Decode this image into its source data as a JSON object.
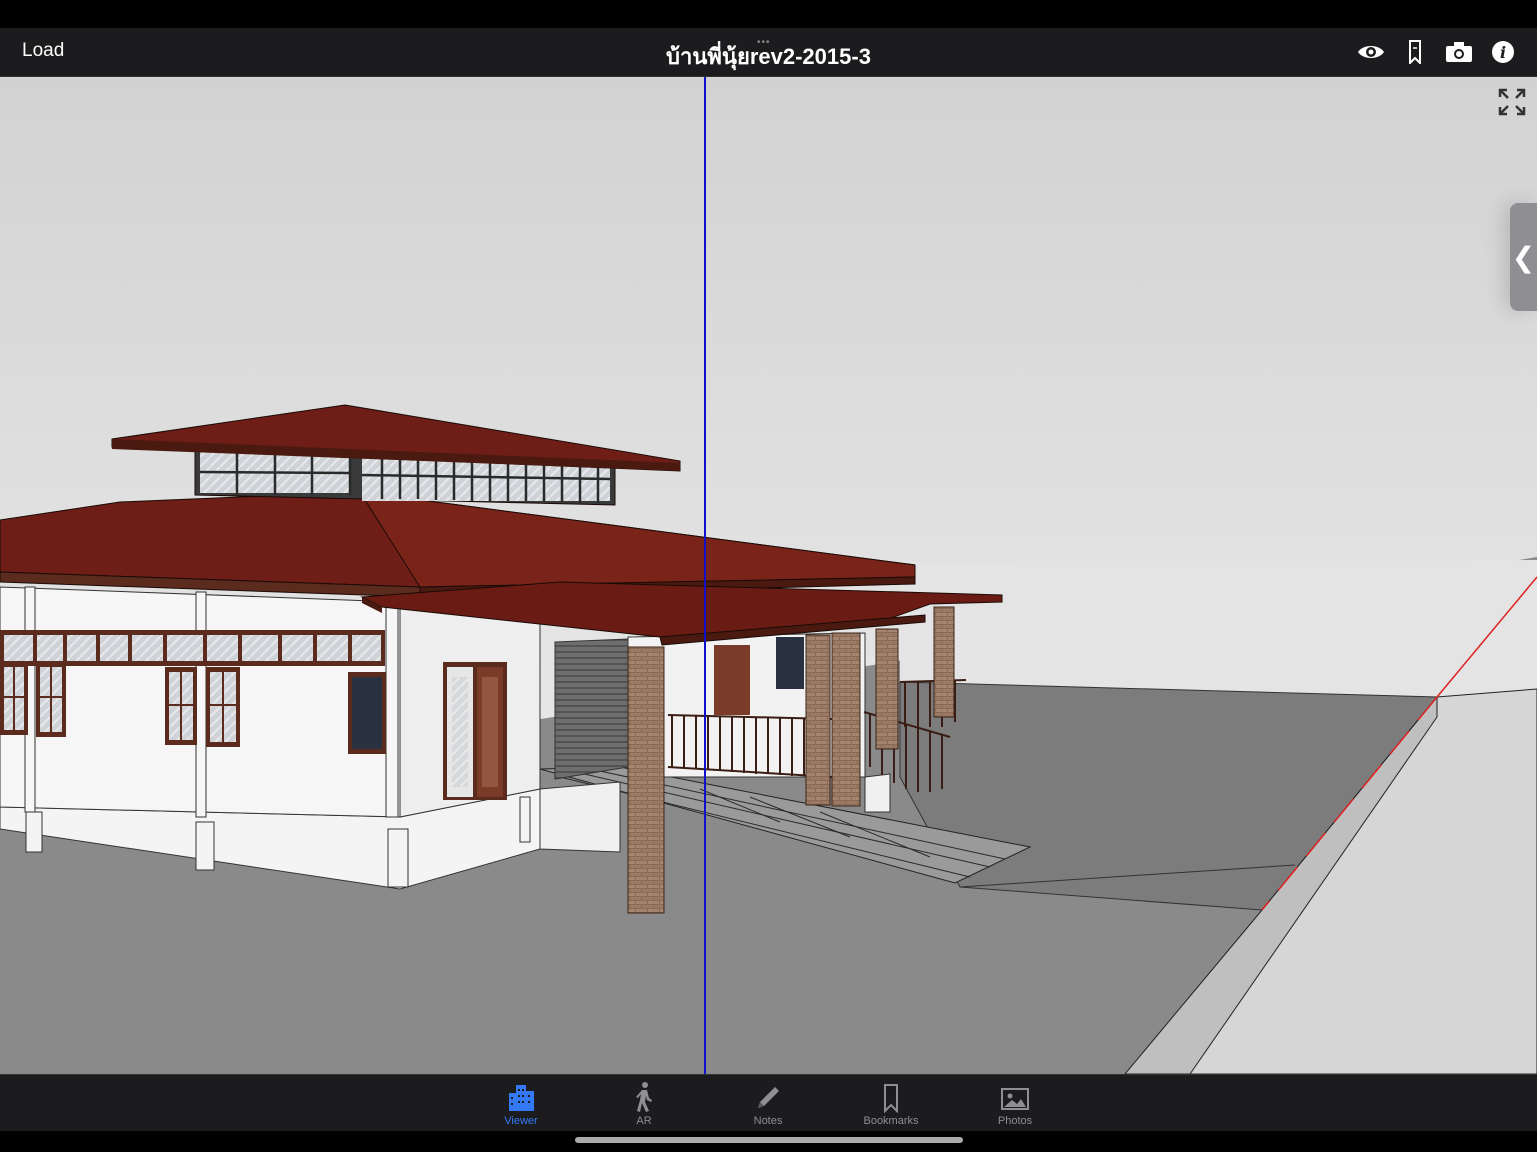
{
  "header": {
    "load_label": "Load",
    "title": "บ้านพี่นุ้ยrev2-2015-3",
    "icons": [
      "eye-icon",
      "bookmark-icon",
      "camera-icon",
      "info-icon"
    ]
  },
  "viewport": {
    "expand_icon": "expand-icon",
    "side_handle_glyph": "❮"
  },
  "tabs": [
    {
      "label": "Viewer",
      "icon": "building-icon",
      "active": true
    },
    {
      "label": "AR",
      "icon": "walking-person-icon",
      "active": false
    },
    {
      "label": "Notes",
      "icon": "pencil-icon",
      "active": false
    },
    {
      "label": "Bookmarks",
      "icon": "bookmark-icon",
      "active": false
    },
    {
      "label": "Photos",
      "icon": "photo-icon",
      "active": false
    }
  ],
  "colors": {
    "accent": "#3478f6",
    "roof": "#6e1e16",
    "axis_blue": "#1010c8",
    "axis_red": "#e02020"
  }
}
